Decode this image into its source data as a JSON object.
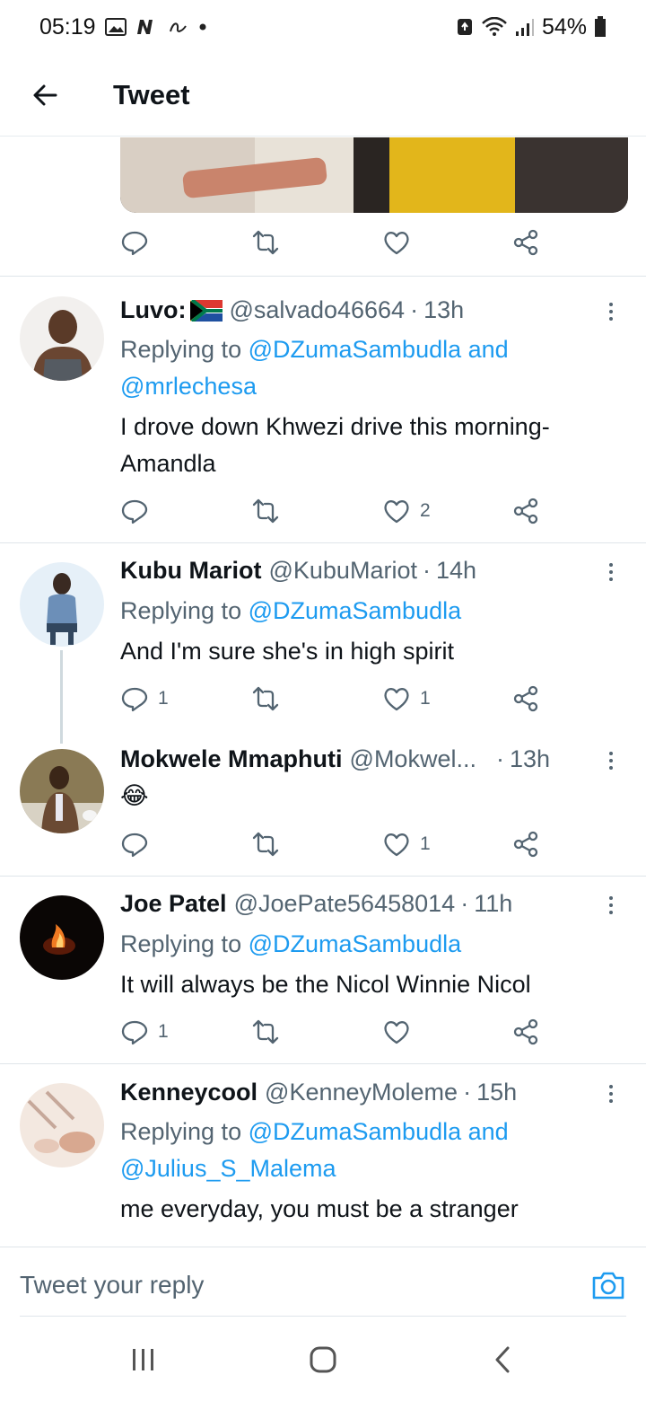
{
  "status_bar": {
    "time": "05:19",
    "battery": "54%"
  },
  "header": {
    "title": "Tweet"
  },
  "reply_bar": {
    "placeholder": "Tweet your reply"
  },
  "replies": [
    {
      "name": "Luvo:",
      "handle": "@salvado46664",
      "time": "13h",
      "replying_prefix": "Replying to",
      "mentions": [
        "@DZumaSambudla",
        "@mrlechesa"
      ],
      "mention_joiner": "and",
      "text_lines": [
        "I drove down Khwezi drive this morning-",
        "Amandla"
      ],
      "counts": {
        "reply": "",
        "retweet": "",
        "like": "2"
      }
    },
    {
      "name": "Kubu Mariot",
      "handle": "@KubuMariot",
      "time": "14h",
      "replying_prefix": "Replying to",
      "mentions": [
        "@DZumaSambudla"
      ],
      "text_lines": [
        "And I'm sure she's in high spirit"
      ],
      "counts": {
        "reply": "1",
        "retweet": "",
        "like": "1"
      }
    },
    {
      "name": "Mokwele Mmaphuti",
      "handle": "@Mokwel...",
      "time": "13h",
      "text_lines": [
        "😂"
      ],
      "counts": {
        "reply": "",
        "retweet": "",
        "like": "1"
      }
    },
    {
      "name": "Joe Patel",
      "handle": "@JoePate56458014",
      "time": "11h",
      "replying_prefix": "Replying to",
      "mentions": [
        "@DZumaSambudla"
      ],
      "text_lines": [
        "It will always be the Nicol Winnie Nicol"
      ],
      "counts": {
        "reply": "1",
        "retweet": "",
        "like": ""
      }
    },
    {
      "name": "Kenneycool",
      "handle": "@KenneyMoleme",
      "time": "15h",
      "replying_prefix": "Replying to",
      "mentions": [
        "@DZumaSambudla",
        "@Julius_S_Malema"
      ],
      "mention_joiner": "and",
      "text_lines": [
        "me everyday, you must be a stranger"
      ]
    }
  ],
  "colors": {
    "accent": "#1d9bf0",
    "secondary_text": "#536471",
    "primary_text": "#0f1419"
  },
  "icons": [
    "back-arrow-icon",
    "reply-icon",
    "retweet-icon",
    "like-icon",
    "share-icon",
    "more-icon",
    "camera-icon",
    "recent-apps-icon",
    "home-icon",
    "back-nav-icon"
  ]
}
